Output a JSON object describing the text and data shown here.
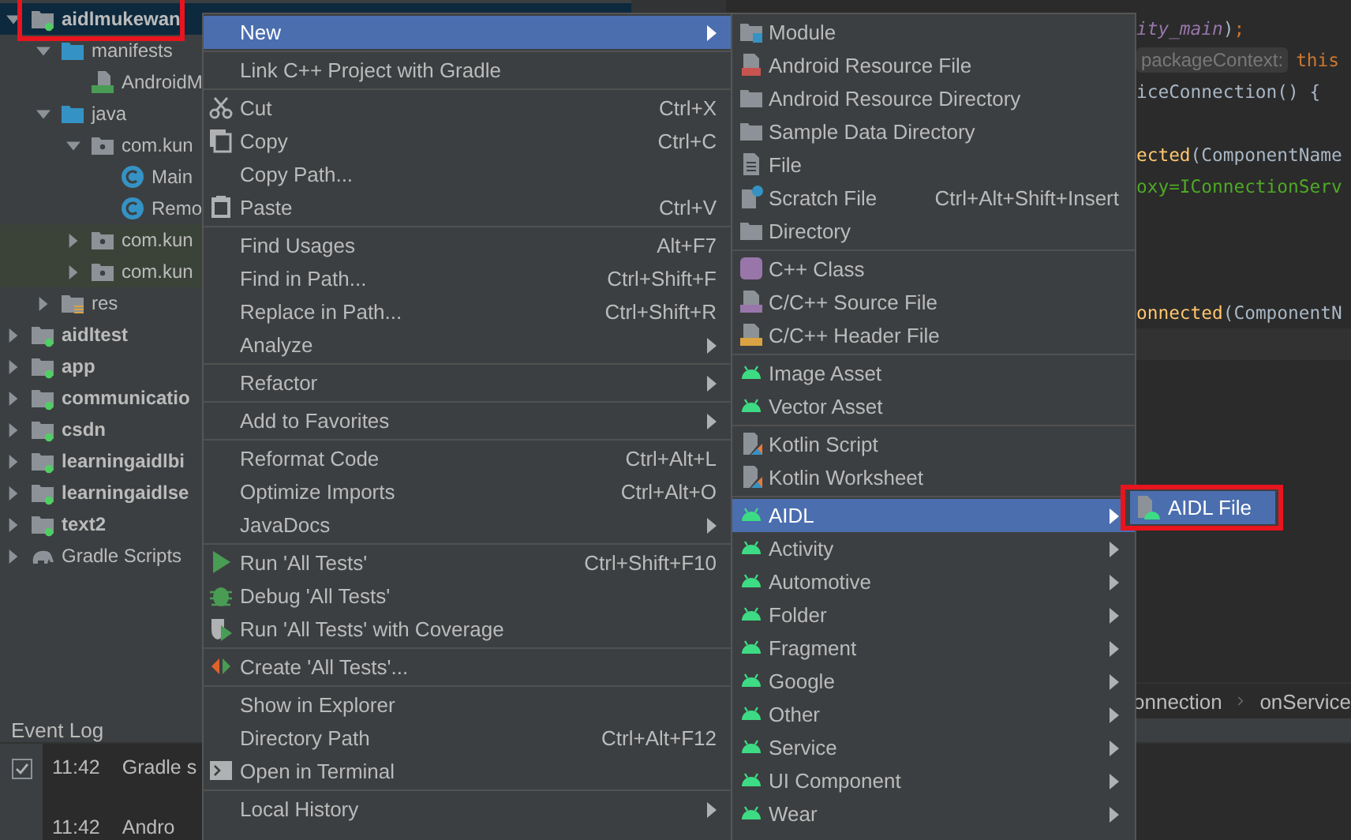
{
  "project_tree": [
    {
      "label": "aidlmukewan",
      "kind": "module",
      "expanded": true,
      "selected": true,
      "outlined": true,
      "children": [
        {
          "label": "manifests",
          "kind": "folder-blue",
          "expanded": true,
          "children": [
            {
              "label": "AndroidM",
              "kind": "manifest"
            }
          ]
        },
        {
          "label": "java",
          "kind": "folder-blue",
          "expanded": true,
          "children": [
            {
              "label": "com.kun",
              "kind": "package",
              "expanded": true,
              "tinted": false,
              "children": [
                {
                  "label": "Main",
                  "kind": "class"
                },
                {
                  "label": "Remo",
                  "kind": "class"
                }
              ]
            },
            {
              "label": "com.kun",
              "kind": "package",
              "expanded": false,
              "tinted": true
            },
            {
              "label": "com.kun",
              "kind": "package",
              "expanded": false,
              "tinted": true
            }
          ]
        },
        {
          "label": "res",
          "kind": "res",
          "expanded": false
        }
      ]
    },
    {
      "label": "aidltest",
      "kind": "module",
      "expanded": false,
      "selected": false,
      "outlined": false
    },
    {
      "label": "app",
      "kind": "module",
      "expanded": false,
      "selected": false,
      "outlined": false
    },
    {
      "label": "communicatio",
      "kind": "module",
      "expanded": false,
      "selected": false,
      "outlined": false
    },
    {
      "label": "csdn",
      "kind": "module",
      "expanded": false,
      "selected": false,
      "outlined": false
    },
    {
      "label": "learningaidlbi",
      "kind": "module",
      "expanded": false,
      "selected": false,
      "outlined": false
    },
    {
      "label": "learningaidlse",
      "kind": "module",
      "expanded": false,
      "selected": false,
      "outlined": false
    },
    {
      "label": "text2",
      "kind": "module",
      "expanded": false,
      "selected": false,
      "outlined": false
    },
    {
      "label": "Gradle Scripts",
      "kind": "gradle",
      "expanded": false,
      "selected": false,
      "outlined": false
    }
  ],
  "editor": {
    "code_lines": [
      {
        "kind": "blank"
      },
      {
        "kind": "code",
        "segments": [
          {
            "kind": "field",
            "text": "ity_main"
          },
          {
            "kind": "plain",
            "text": ")"
          },
          {
            "kind": "keyword",
            "text": ";"
          }
        ]
      },
      {
        "kind": "code",
        "segments": [
          {
            "kind": "hint",
            "text": "packageContext:"
          },
          {
            "kind": "keyword",
            "text": "this"
          }
        ]
      },
      {
        "kind": "code",
        "segments": [
          {
            "kind": "plain",
            "text": "iceConnection() {"
          }
        ]
      },
      {
        "kind": "blank"
      },
      {
        "kind": "code",
        "segments": [
          {
            "kind": "method",
            "text": "ected"
          },
          {
            "kind": "plain",
            "text": "(ComponentName"
          }
        ]
      },
      {
        "kind": "code",
        "segments": [
          {
            "kind": "string",
            "text": "oxy=IConnectionServ"
          }
        ]
      },
      {
        "kind": "blank"
      },
      {
        "kind": "blank"
      },
      {
        "kind": "blank"
      },
      {
        "kind": "code",
        "segments": [
          {
            "kind": "method",
            "text": "onnected"
          },
          {
            "kind": "plain",
            "text": "(ComponentN"
          }
        ]
      },
      {
        "kind": "current-line"
      }
    ],
    "breadcrumbs": [
      "onnection",
      "onService"
    ]
  },
  "event_log": {
    "title": "Event Log",
    "entries": [
      {
        "time": "11:42",
        "message": "Gradle s"
      },
      {
        "time": "11:42",
        "message": "Andro"
      }
    ]
  },
  "context_menu": {
    "groups": [
      [
        {
          "label": "New",
          "kind": "plain",
          "submenu": true,
          "selected": true
        }
      ],
      [
        {
          "label": "Link C++ Project with Gradle",
          "kind": "plain",
          "submenu": false,
          "selected": false
        }
      ],
      [
        {
          "label": "Cut",
          "kind": "scissors",
          "shortcut": "Ctrl+X",
          "submenu": false,
          "selected": false
        },
        {
          "label": "Copy",
          "kind": "copy",
          "shortcut": "Ctrl+C",
          "submenu": false,
          "selected": false
        },
        {
          "label": "Copy Path...",
          "kind": "plain",
          "submenu": false,
          "selected": false
        },
        {
          "label": "Paste",
          "kind": "paste",
          "shortcut": "Ctrl+V",
          "submenu": false,
          "selected": false
        }
      ],
      [
        {
          "label": "Find Usages",
          "kind": "plain",
          "shortcut": "Alt+F7",
          "submenu": false,
          "selected": false
        },
        {
          "label": "Find in Path...",
          "kind": "plain",
          "shortcut": "Ctrl+Shift+F",
          "submenu": false,
          "selected": false
        },
        {
          "label": "Replace in Path...",
          "kind": "plain",
          "shortcut": "Ctrl+Shift+R",
          "submenu": false,
          "selected": false
        },
        {
          "label": "Analyze",
          "kind": "plain",
          "submenu": true,
          "selected": false
        }
      ],
      [
        {
          "label": "Refactor",
          "kind": "plain",
          "submenu": true,
          "selected": false
        }
      ],
      [
        {
          "label": "Add to Favorites",
          "kind": "plain",
          "submenu": true,
          "selected": false
        }
      ],
      [
        {
          "label": "Reformat Code",
          "kind": "plain",
          "shortcut": "Ctrl+Alt+L",
          "submenu": false,
          "selected": false
        },
        {
          "label": "Optimize Imports",
          "kind": "plain",
          "shortcut": "Ctrl+Alt+O",
          "submenu": false,
          "selected": false
        },
        {
          "label": "JavaDocs",
          "kind": "plain",
          "submenu": true,
          "selected": false
        }
      ],
      [
        {
          "label": "Run 'All Tests'",
          "kind": "run",
          "shortcut": "Ctrl+Shift+F10",
          "submenu": false,
          "selected": false
        },
        {
          "label": "Debug 'All Tests'",
          "kind": "debug",
          "submenu": false,
          "selected": false
        },
        {
          "label": "Run 'All Tests' with Coverage",
          "kind": "coverage",
          "submenu": false,
          "selected": false
        }
      ],
      [
        {
          "label": "Create 'All Tests'...",
          "kind": "create",
          "submenu": false,
          "selected": false
        }
      ],
      [
        {
          "label": "Show in Explorer",
          "kind": "plain",
          "submenu": false,
          "selected": false
        },
        {
          "label": "Directory Path",
          "kind": "plain",
          "shortcut": "Ctrl+Alt+F12",
          "submenu": false,
          "selected": false
        },
        {
          "label": "Open in Terminal",
          "kind": "terminal",
          "submenu": false,
          "selected": false
        }
      ],
      [
        {
          "label": "Local History",
          "kind": "plain",
          "submenu": true,
          "selected": false
        }
      ]
    ]
  },
  "new_submenu": {
    "groups": [
      [
        {
          "label": "Module",
          "kind": "module",
          "submenu": false,
          "selected": false
        },
        {
          "label": "Android Resource File",
          "kind": "resource-file",
          "submenu": false,
          "selected": false
        },
        {
          "label": "Android Resource Directory",
          "kind": "folder",
          "submenu": false,
          "selected": false
        },
        {
          "label": "Sample Data Directory",
          "kind": "folder",
          "submenu": false,
          "selected": false
        },
        {
          "label": "File",
          "kind": "file",
          "submenu": false,
          "selected": false
        },
        {
          "label": "Scratch File",
          "kind": "scratch",
          "shortcut": "Ctrl+Alt+Shift+Insert",
          "submenu": false,
          "selected": false
        },
        {
          "label": "Directory",
          "kind": "folder",
          "submenu": false,
          "selected": false
        }
      ],
      [
        {
          "label": "C++ Class",
          "kind": "cpp-class",
          "submenu": false,
          "selected": false
        },
        {
          "label": "C/C++ Source File",
          "kind": "cpp-source",
          "submenu": false,
          "selected": false
        },
        {
          "label": "C/C++ Header File",
          "kind": "cpp-header",
          "submenu": false,
          "selected": false
        }
      ],
      [
        {
          "label": "Image Asset",
          "kind": "android",
          "submenu": false,
          "selected": false
        },
        {
          "label": "Vector Asset",
          "kind": "android",
          "submenu": false,
          "selected": false
        }
      ],
      [
        {
          "label": "Kotlin Script",
          "kind": "kotlin",
          "submenu": false,
          "selected": false
        },
        {
          "label": "Kotlin Worksheet",
          "kind": "kotlin",
          "submenu": false,
          "selected": false
        }
      ],
      [
        {
          "label": "AIDL",
          "kind": "android",
          "submenu": true,
          "selected": true
        },
        {
          "label": "Activity",
          "kind": "android",
          "submenu": true,
          "selected": false
        },
        {
          "label": "Automotive",
          "kind": "android",
          "submenu": true,
          "selected": false
        },
        {
          "label": "Folder",
          "kind": "android",
          "submenu": true,
          "selected": false
        },
        {
          "label": "Fragment",
          "kind": "android",
          "submenu": true,
          "selected": false
        },
        {
          "label": "Google",
          "kind": "android",
          "submenu": true,
          "selected": false
        },
        {
          "label": "Other",
          "kind": "android",
          "submenu": true,
          "selected": false
        },
        {
          "label": "Service",
          "kind": "android",
          "submenu": true,
          "selected": false
        },
        {
          "label": "UI Component",
          "kind": "android",
          "submenu": true,
          "selected": false
        },
        {
          "label": "Wear",
          "kind": "android",
          "submenu": true,
          "selected": false
        }
      ]
    ]
  },
  "aidl_submenu": {
    "items": [
      {
        "label": "AIDL File",
        "kind": "aidl-file",
        "selected": true,
        "outlined": true
      }
    ]
  }
}
